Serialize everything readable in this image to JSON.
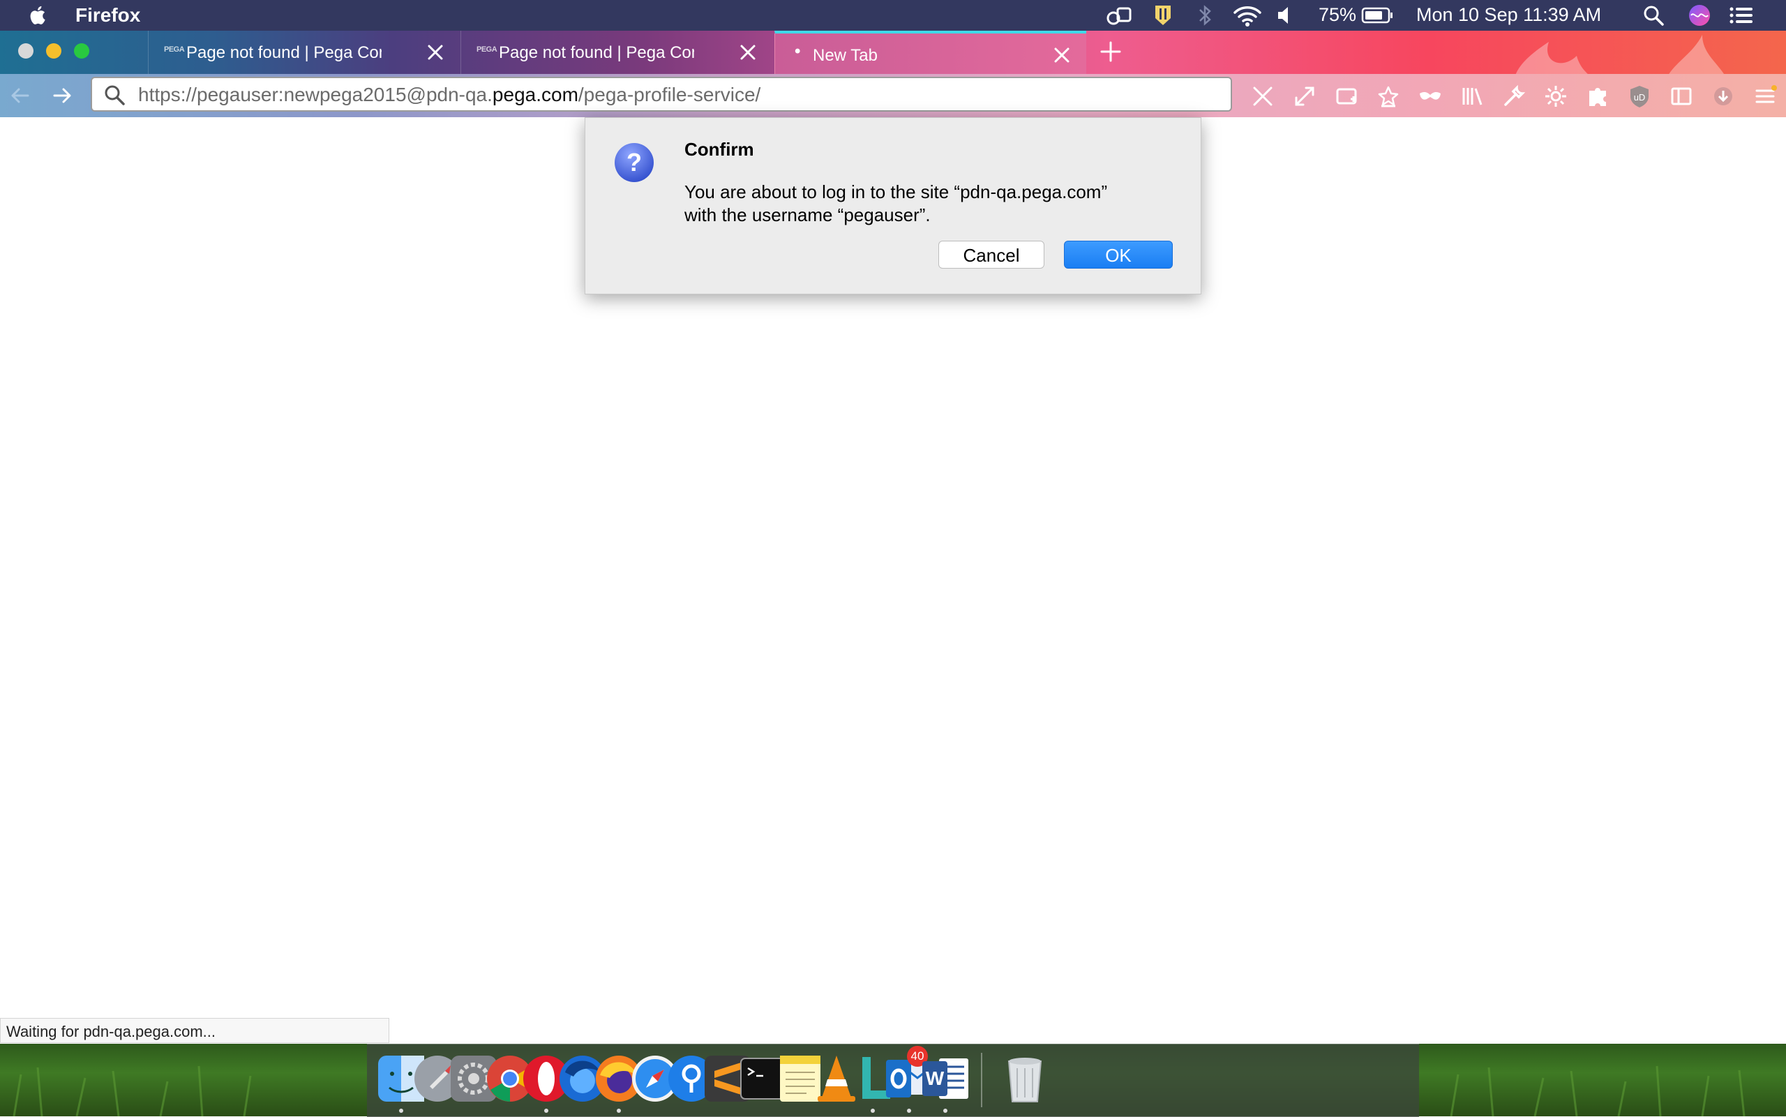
{
  "menubar": {
    "app_name": "Firefox",
    "battery": "75%",
    "datetime": "Mon 10 Sep  11:39 AM",
    "icons": [
      "apple-icon",
      "creative-cloud-icon",
      "password-manager-icon",
      "bluetooth-icon",
      "wifi-icon",
      "volume-icon",
      "battery-icon",
      "spotlight-icon",
      "siri-icon",
      "notification-center-icon"
    ]
  },
  "tabs": [
    {
      "favicon": "PEGA",
      "title": "Page not found | Pega Community"
    },
    {
      "favicon": "PEGA",
      "title": "Page not found | Pega Community"
    },
    {
      "favicon": "•",
      "title": "New Tab"
    }
  ],
  "urlbar": {
    "prefix": "https://pegauser:newpega2015@pdn-qa.",
    "domain": "pega.com",
    "suffix": "/pega-profile-service/"
  },
  "dialog": {
    "title": "Confirm",
    "message_line1": "You are about to log in to the site “pdn-qa.pega.com”",
    "message_line2": "with the username “pegauser”.",
    "cancel_label": "Cancel",
    "ok_label": "OK"
  },
  "status": {
    "text": "Waiting for pdn-qa.pega.com..."
  },
  "dock": {
    "apps": [
      "Finder",
      "Launchpad",
      "System Preferences",
      "Google Chrome",
      "Opera",
      "Firefox Developer Edition",
      "Firefox",
      "Safari",
      "1Password",
      "Sublime Text",
      "Terminal",
      "Notes",
      "VLC",
      "Lingo",
      "Outlook",
      "Word",
      "Trash"
    ],
    "outlook_badge": "40"
  },
  "colors": {
    "accent": "#1a7ef3",
    "menubar": "#33385f",
    "badge": "#e8332b"
  }
}
